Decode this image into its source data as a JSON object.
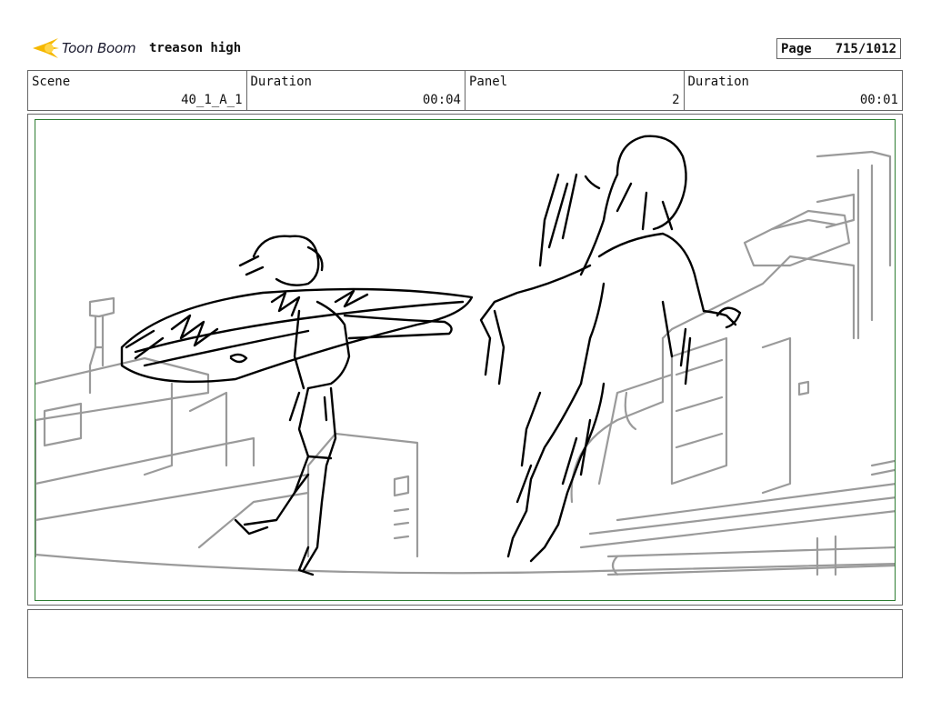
{
  "header": {
    "logo_text": "Toon Boom",
    "project_title": "treason high",
    "page_label": "Page",
    "page_value": "715/1012"
  },
  "info": {
    "scene_label": "Scene",
    "scene_value": "40_1_A_1",
    "duration1_label": "Duration",
    "duration1_value": "00:04",
    "panel_label": "Panel",
    "panel_value": "2",
    "duration2_label": "Duration",
    "duration2_value": "00:01"
  },
  "colors": {
    "logo_accent": "#f5b800",
    "panel_frame": "#2e7d32",
    "sketch_line": "#000000",
    "background_line": "#9a9a9a"
  }
}
